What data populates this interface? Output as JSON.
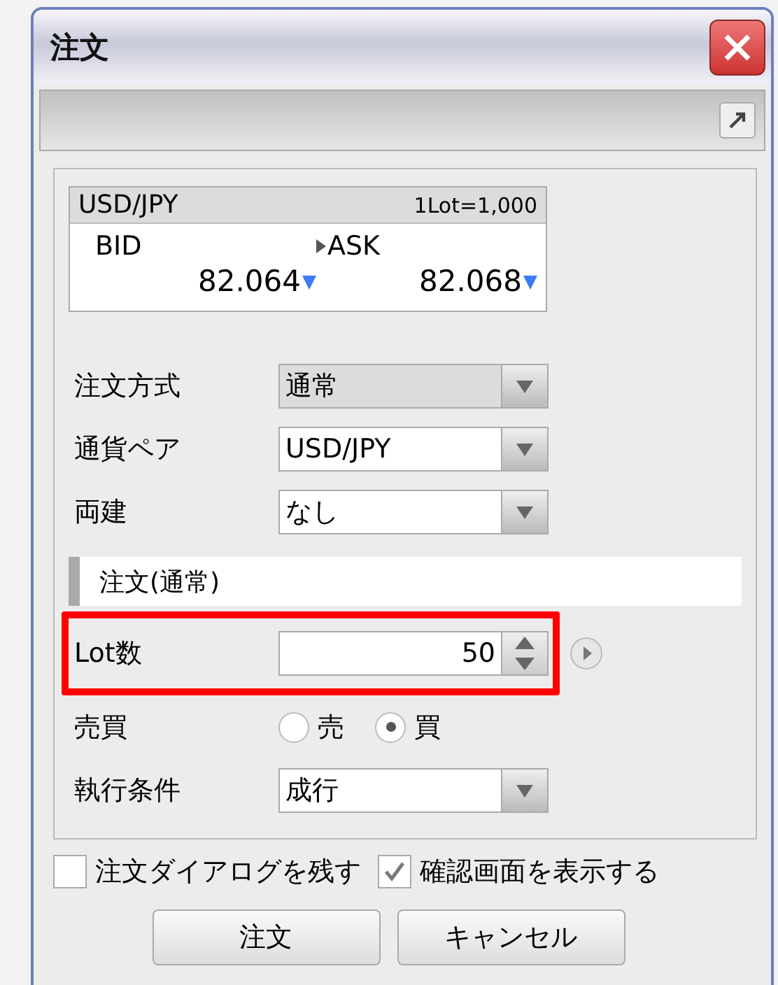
{
  "window": {
    "title": "注文"
  },
  "quote": {
    "symbol": "USD/JPY",
    "lot_size": "1Lot=1,000",
    "sides": [
      {
        "label": "BID",
        "price": "82.064",
        "falling": true,
        "pointer": false
      },
      {
        "label": "ASK",
        "price": "82.068",
        "falling": true,
        "pointer": true
      }
    ]
  },
  "fields": [
    {
      "kind": "select",
      "label": "注文方式",
      "value": "通常",
      "disabled": true,
      "highlighted": false
    },
    {
      "kind": "select",
      "label": "通貨ペア",
      "value": "USD/JPY",
      "disabled": false,
      "highlighted": false
    },
    {
      "kind": "select",
      "label": "両建",
      "value": "なし",
      "disabled": false,
      "highlighted": false
    },
    {
      "kind": "section",
      "label": "注文(通常)"
    },
    {
      "kind": "number",
      "label": "Lot数",
      "value": "50",
      "disabled": false,
      "highlighted": true
    },
    {
      "kind": "radio",
      "label": "売買",
      "options": [
        {
          "label": "売",
          "selected": false
        },
        {
          "label": "買",
          "selected": true
        }
      ]
    },
    {
      "kind": "select",
      "label": "執行条件",
      "value": "成行",
      "disabled": false,
      "highlighted": false
    }
  ],
  "checkboxes": [
    {
      "label": "注文ダイアログを残す",
      "checked": false
    },
    {
      "label": "確認画面を表示する",
      "checked": true
    }
  ],
  "buttons": [
    "注文",
    "キャンセル"
  ]
}
